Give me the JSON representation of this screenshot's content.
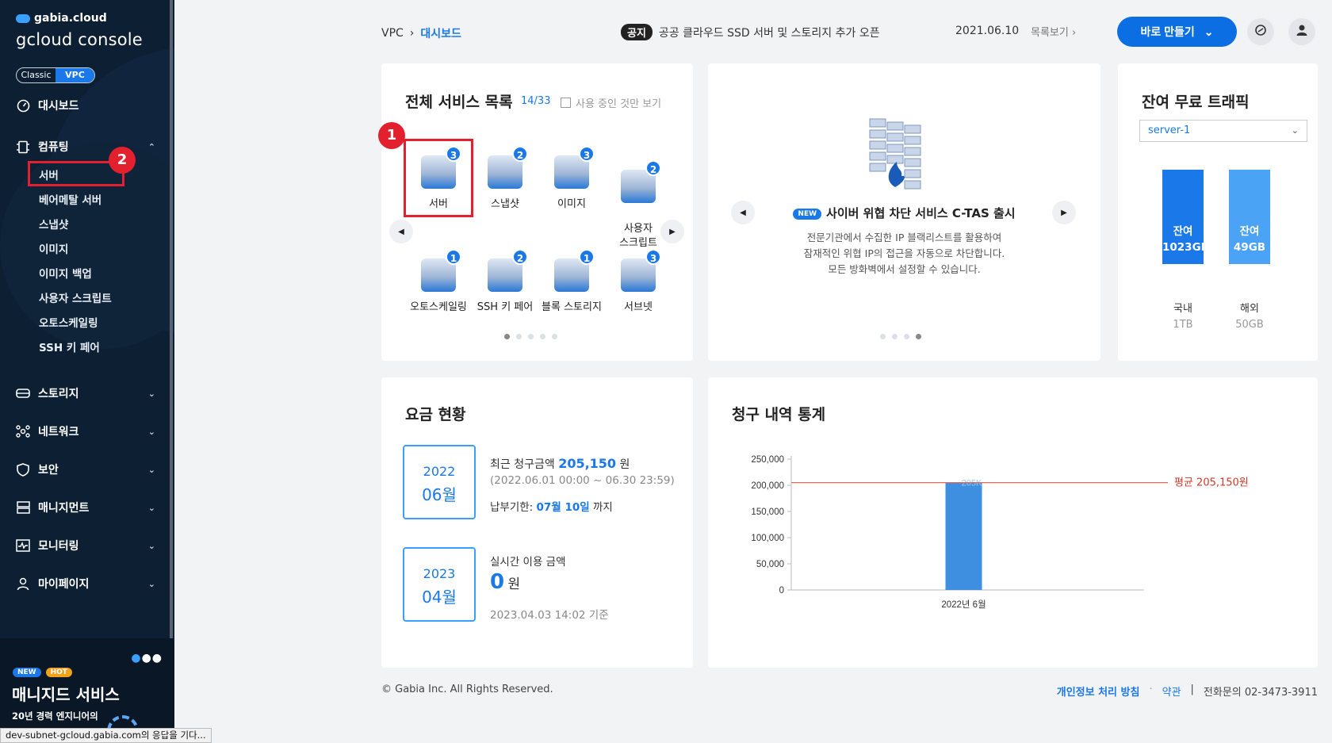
{
  "sidebar": {
    "brand_small": "gabia.cloud",
    "brand_big": "gcloud console",
    "toggle": [
      "Classic",
      "VPC"
    ],
    "dashboard": "대시보드",
    "computing": "컴퓨팅",
    "computing_items": [
      "서버",
      "베어메탈 서버",
      "스냅샷",
      "이미지",
      "이미지 백업",
      "사용자 스크립트",
      "오토스케일링",
      "SSH 키 페어"
    ],
    "sections": [
      "스토리지",
      "네트워크",
      "보안",
      "매니지먼트",
      "모니터링",
      "마이페이지"
    ],
    "promo": {
      "tag_new": "NEW",
      "tag_hot": "HOT",
      "title": "매니지드 서비스",
      "desc": "20년 경력 엔지니어의"
    }
  },
  "annotations": {
    "one": "1",
    "two": "2"
  },
  "header": {
    "crumb_root": "VPC",
    "crumb_current": "대시보드",
    "notice_label": "공지",
    "notice_text": "공공 클라우드 SSD 서버 및 스토리지 추가 오픈",
    "notice_date": "2021.06.10",
    "notice_more": "목록보기",
    "make_button": "바로 만들기"
  },
  "services": {
    "title": "전체 서비스 목록",
    "count": "14/33",
    "filter_label": "사용 중인 것만 보기",
    "items": [
      {
        "label": "서버",
        "count": "3"
      },
      {
        "label": "스냅샷",
        "count": "2"
      },
      {
        "label": "이미지",
        "count": "3"
      },
      {
        "label": "사용자\n스크립트",
        "count": "2"
      },
      {
        "label": "오토스케일링",
        "count": "1"
      },
      {
        "label": "SSH 키 페어",
        "count": "2"
      },
      {
        "label": "블록 스토리지",
        "count": "1"
      },
      {
        "label": "서브넷",
        "count": "3"
      }
    ]
  },
  "banner": {
    "new_tag": "NEW",
    "title": "사이버 위협 차단 서비스 C-TAS 출시",
    "desc_1": "전문기관에서 수집한 IP 블랙리스트를 활용하여",
    "desc_2": "잠재적인 위협 IP의 접근을 자동으로 차단합니다.",
    "desc_3": "모든 방화벽에서 설정할 수 있습니다."
  },
  "traffic": {
    "title": "잔여 무료 트래픽",
    "server": "server-1",
    "domestic": {
      "label": "잔여",
      "value": "1023GB",
      "name": "국내",
      "total": "1TB",
      "color": "#1a78e8"
    },
    "overseas": {
      "label": "잔여",
      "value": "49GB",
      "name": "해외",
      "total": "50GB",
      "color": "#4aa3f5"
    }
  },
  "billing": {
    "title": "요금 현황",
    "recent_year": "2022",
    "recent_month": "06월",
    "recent_label": "최근 청구금액",
    "recent_amount": "205,150",
    "won": "원",
    "recent_period": "(2022.06.01 00:00 ~ 06.30 23:59)",
    "due_label": "납부기한:",
    "due_date": "07월 10일",
    "due_suffix": "까지",
    "realtime_year": "2023",
    "realtime_month": "04월",
    "realtime_label": "실시간 이용 금액",
    "realtime_amount": "0",
    "realtime_time": "2023.04.03 14:02 기준"
  },
  "chart_data": {
    "type": "bar",
    "title": "청구 내역 통계",
    "categories": [
      "2022년 6월"
    ],
    "values": [
      205150
    ],
    "data_labels": [
      "205K"
    ],
    "ylim": [
      0,
      250000
    ],
    "yticks": [
      "0",
      "50,000",
      "100,000",
      "150,000",
      "200,000",
      "250,000"
    ],
    "average": 205150,
    "average_label": "평균 205,150원",
    "bar_color": "#3f8fe0",
    "average_color": "#e06a5a"
  },
  "footer": {
    "copyright": "© Gabia Inc. All Rights Reserved.",
    "privacy": "개인정보 처리 방침",
    "terms": "약관",
    "contact": "전화문의  02-3473-3911"
  },
  "statusbar": "dev-subnet-gcloud.gabia.com의 응답을 기다..."
}
